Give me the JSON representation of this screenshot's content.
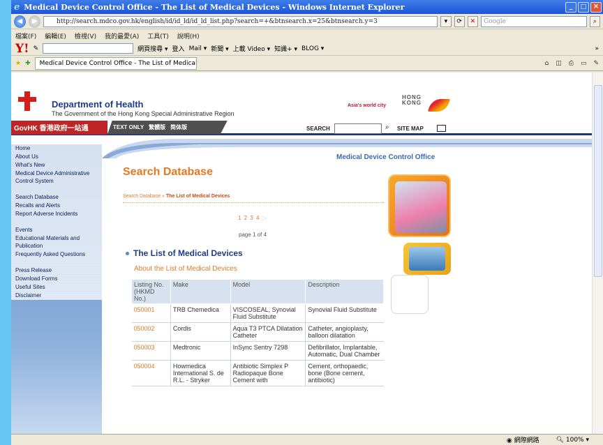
{
  "browser": {
    "title": "Medical Device Control Office - The List of Medical Devices - Windows Internet Explorer",
    "url": "http://search.mdco.gov.hk/english/id/id_ld/id_ld_list.php?search=+&btnsearch.x=25&btnsearch.y=3",
    "search_placeholder": "Google",
    "menu": [
      "檔案(F)",
      "編輯(E)",
      "檢視(V)",
      "我的最愛(A)",
      "工具(T)",
      "說明(H)"
    ],
    "yahoo_items": [
      "網頁搜尋 ▾",
      "登入",
      "Mail ▾",
      "新聞 ▾",
      "上載 Video ▾",
      "知識+ ▾",
      "BLOG ▾",
      "»"
    ],
    "tab_title": "Medical Device Control Office - The List of Medical De...",
    "status_zone": "網際網路",
    "zoom": "100%"
  },
  "header": {
    "department": "Department of Health",
    "government": "The Government of the Hong Kong Special Administrative Region",
    "tagline": "Asia's world city",
    "hk_logo_line1": "HONG",
    "hk_logo_line2": "KONG",
    "govhk": "GovHK 香港政府一站通",
    "text_only": "TEXT ONLY",
    "trad_chinese": "繁體版",
    "simp_chinese": "简体版",
    "search_label": "SEARCH",
    "site_map": "SITE MAP"
  },
  "sidebar": {
    "items": [
      {
        "label": "Home"
      },
      {
        "label": "About Us"
      },
      {
        "label": "What's New"
      },
      {
        "label": "Medical Device Administrative Control System"
      },
      {
        "label": "Search Database"
      },
      {
        "label": "Recalls and Alerts"
      },
      {
        "label": "Report Adverse Incidents"
      },
      {
        "label": "Events"
      },
      {
        "label": "Educational Materials and Publication"
      },
      {
        "label": "Frequently Asked Questions"
      },
      {
        "label": "Press Release"
      },
      {
        "label": "Download Forms"
      },
      {
        "label": "Useful Sites"
      },
      {
        "label": "Disclaimer"
      }
    ]
  },
  "content": {
    "office": "Medical Device Control Office",
    "heading": "Search Database",
    "breadcrumb_parent": "Search Database",
    "breadcrumb_sep": "»",
    "breadcrumb_current": "The List of Medical Devices",
    "pages": "1 2 3 4",
    "page_of": "page 1 of 4",
    "list_title": "The List of Medical Devices",
    "about_link": "About the List of Medical Devices",
    "table_headers": [
      "Listing No. (HKMD No.)",
      "Make",
      "Model",
      "Description"
    ],
    "rows": [
      {
        "no": "050001",
        "make": "TRB Chemedica",
        "model": "VISCOSEAL, Synovial Fluid Substitute",
        "desc": "Synovial Fluid Substitute"
      },
      {
        "no": "050002",
        "make": "Cordis",
        "model": "Aqua T3 PTCA Dilatation Catheter",
        "desc": "Catheter, angioplasty, balloon dilatation"
      },
      {
        "no": "050003",
        "make": "Medtronic",
        "model": "InSync Sentry 7298",
        "desc": "Defibrillator, Implantable, Automatic, Dual Chamber"
      },
      {
        "no": "050004",
        "make": "Howmedica International S. de R.L. - Stryker",
        "model": "Antibiotic Simplex P Radiopaque Bone Cement with",
        "desc": "Cement, orthopaedic, bone (Bone cement, antibiotic)"
      }
    ]
  }
}
